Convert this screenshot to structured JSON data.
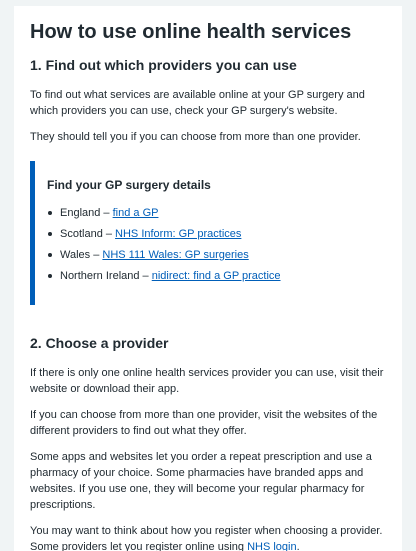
{
  "page": {
    "title": "How to use online health services"
  },
  "section1": {
    "heading": "1. Find out which providers you can use",
    "paragraphs": [
      "To find out what services are available online at your GP surgery and which providers you can use, check your GP surgery's website.",
      "They should tell you if you can choose from more than one provider."
    ]
  },
  "gp_details": {
    "heading": "Find your GP surgery details",
    "items": [
      {
        "prefix": "England – ",
        "link_text": "find a GP"
      },
      {
        "prefix": "Scotland – ",
        "link_text": "NHS Inform: GP practices"
      },
      {
        "prefix": "Wales – ",
        "link_text": "NHS 111 Wales: GP surgeries"
      },
      {
        "prefix": "Northern Ireland – ",
        "link_text": "nidirect: find a GP practice"
      }
    ]
  },
  "section2": {
    "heading": "2. Choose a provider",
    "paragraphs": [
      "If there is only one online health services provider you can use, visit their website or download their app.",
      "If you can choose from more than one provider, visit the websites of the different providers to find out what they offer.",
      "Some apps and websites let you order a repeat prescription and use a pharmacy of your choice. Some pharmacies have branded apps and websites. If you use one, they will become your regular pharmacy for prescriptions."
    ],
    "last_paragraph_prefix": "You may want to think about how you register when choosing a provider. Some providers let you register online using ",
    "last_paragraph_link": "NHS login",
    "last_paragraph_suffix": "."
  },
  "colors": {
    "link": "#005eb8",
    "text": "#212b32",
    "page_bg": "#f0f4f5",
    "panel_bg": "#ffffff",
    "info_border": "#005eb8"
  }
}
